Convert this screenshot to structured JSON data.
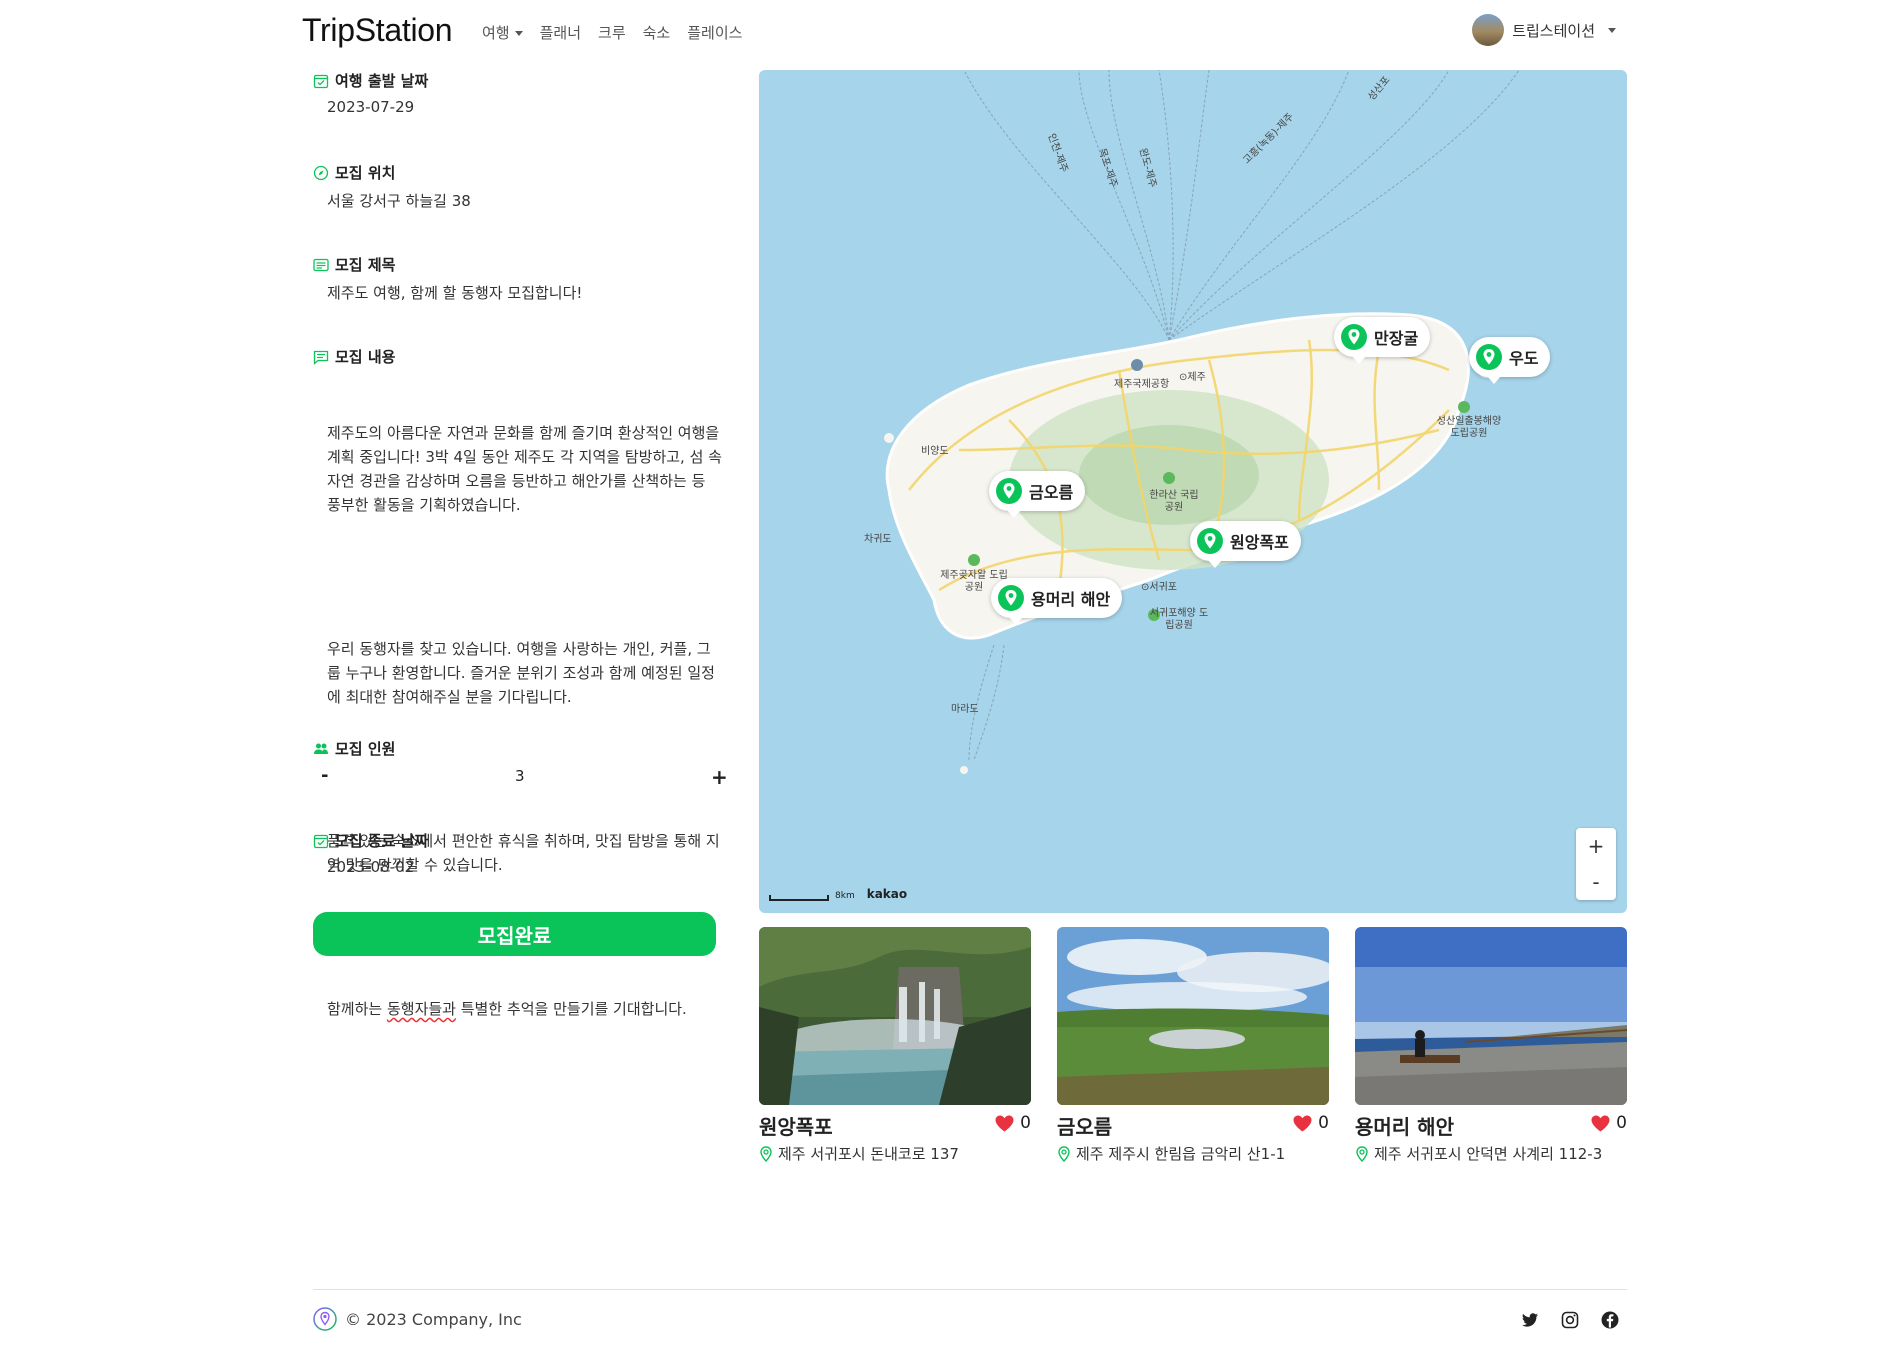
{
  "header": {
    "brand": "TripStation",
    "nav": [
      {
        "label": "여행",
        "dropdown": true
      },
      {
        "label": "플래너",
        "dropdown": false
      },
      {
        "label": "크루",
        "dropdown": false
      },
      {
        "label": "숙소",
        "dropdown": false
      },
      {
        "label": "플레이스",
        "dropdown": false
      }
    ],
    "user_name": "트립스테이션"
  },
  "form": {
    "start_date_label": "여행 출발 날짜",
    "start_date": "2023-07-29",
    "location_label": "모집 위치",
    "location": "서울 강서구 하늘길 38",
    "title_label": "모집 제목",
    "title": "제주도 여행, 함께 할 동행자 모집합니다!",
    "content_label": "모집 내용",
    "content_p1": "제주도의 아름다운 자연과 문화를 함께 즐기며 환상적인 여행을 계획 중입니다! 3박 4일 동안 제주도 각 지역을 탐방하고, 섬 속 자연 경관을 감상하며 오름을 등반하고 해안가를 산책하는 등 풍부한 활동을 기획하였습니다.",
    "content_p2": "우리 동행자를 찾고 있습니다. 여행을 사랑하는 개인, 커플, 그룹 누구나 환영합니다. 즐거운 분위기 조성과 함께 예정된 일정에 최대한 참여해주실 분을 기다립니다.",
    "content_p3": "품격 있는 숙소에서 편안한 휴식을 취하며, 맛집 탐방을 통해 지역 맛을 만끽할 수 있습니다.",
    "content_p4_a": "함께하는 ",
    "content_p4_b": "동행자들과",
    "content_p4_c": " 특별한 추억을 만들기를 기대합니다.",
    "members_label": "모집 인원",
    "members_minus": "-",
    "members_count": "3",
    "members_plus": "+",
    "end_date_label": "모집 종료 날짜",
    "end_date": "2023-08-02",
    "submit_label": "모집완료"
  },
  "map": {
    "markers": [
      {
        "name": "만장굴"
      },
      {
        "name": "우도"
      },
      {
        "name": "금오름"
      },
      {
        "name": "원앙폭포"
      },
      {
        "name": "용머리 해안"
      }
    ],
    "labels": {
      "jeju_city": "⊙제주",
      "jeju_airport": "제주국제공항",
      "seogwipo": "⊙서귀포",
      "biyangdo": "비양도",
      "chagwido": "차귀도",
      "marado": "마라도",
      "hallasan": "한라산 국립공원",
      "seongsan": "성산일출봉해양 도립공원",
      "jeju_gotjawal": "제주곶자왈 도립공원",
      "seogwipo_marine": "서귀포해양 도립공원",
      "route_incheon": "인천-제주",
      "route_mokpo": "목포-제주",
      "route_wando": "완도-제주",
      "route_busan": "고흥(녹동)-제주",
      "route_seongsan": "성산포"
    },
    "zoom_in": "+",
    "zoom_out": "-",
    "scale_label": "8km",
    "provider": "kakao"
  },
  "places": [
    {
      "name": "원앙폭포",
      "likes": "0",
      "address": "제주 서귀포시 돈내코로 137"
    },
    {
      "name": "금오름",
      "likes": "0",
      "address": "제주 제주시 한림읍 금악리 산1-1"
    },
    {
      "name": "용머리 해안",
      "likes": "0",
      "address": "제주 서귀포시 안덕면 사계리 112-3"
    }
  ],
  "footer": {
    "copyright": "© 2023 Company, Inc"
  },
  "colors": {
    "accent_green": "#0ac45a",
    "heart_red": "#e8323f",
    "sea": "#a6d4ea"
  }
}
